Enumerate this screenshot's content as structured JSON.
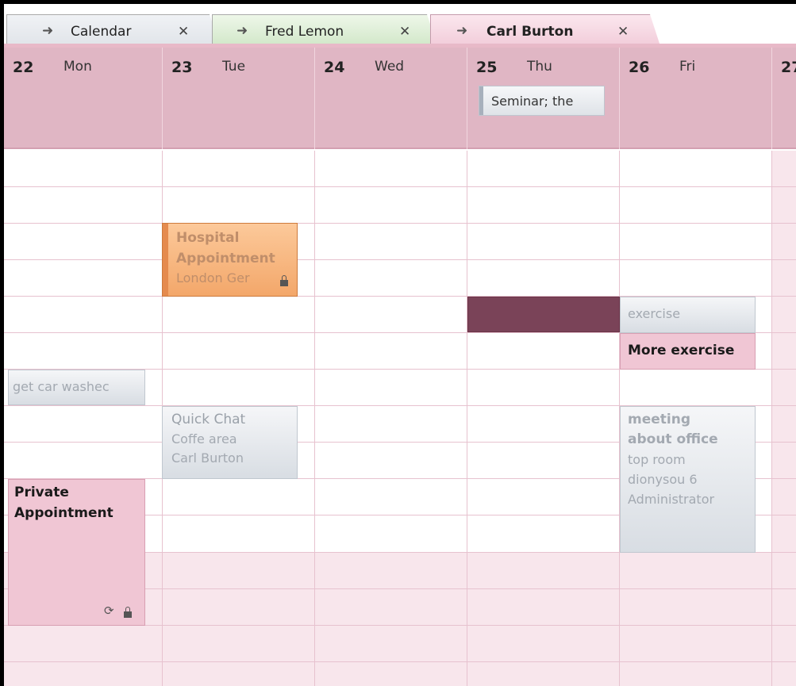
{
  "tabs": [
    {
      "label": "Calendar",
      "arrow": "➜",
      "close": "✕"
    },
    {
      "label": "Fred Lemon",
      "arrow": "➜",
      "close": "✕"
    },
    {
      "label": "Carl Burton",
      "arrow": "➜",
      "close": "✕"
    }
  ],
  "days": [
    {
      "num": "22",
      "name": "Mon"
    },
    {
      "num": "23",
      "name": "Tue"
    },
    {
      "num": "24",
      "name": "Wed"
    },
    {
      "num": "25",
      "name": "Thu"
    },
    {
      "num": "26",
      "name": "Fri"
    },
    {
      "num": "27",
      "name": ""
    }
  ],
  "allday_event": {
    "text": "Seminar; the"
  },
  "events": {
    "hospital": {
      "line1": "Hospital",
      "line2": "Appointment",
      "line3": "London Ger"
    },
    "car_wash": {
      "line1": "get car washec"
    },
    "quick_chat": {
      "line1": "Quick Chat",
      "line2": "Coffe area",
      "line3": "Carl Burton"
    },
    "private": {
      "line1": "Private",
      "line2": "Appointment",
      "recur_icon": "⟳"
    },
    "exercise": {
      "line1": "exercise"
    },
    "more_exercise": {
      "line1": "More exercise"
    },
    "meeting": {
      "line1": "meeting",
      "line2": "about office",
      "line3": "top room",
      "line4": "dionysou 6",
      "line5": "Administrator"
    }
  },
  "colors": {
    "header": "#e0b6c4",
    "accent_dark": "#7a4358",
    "orange": "#f3a76a"
  }
}
